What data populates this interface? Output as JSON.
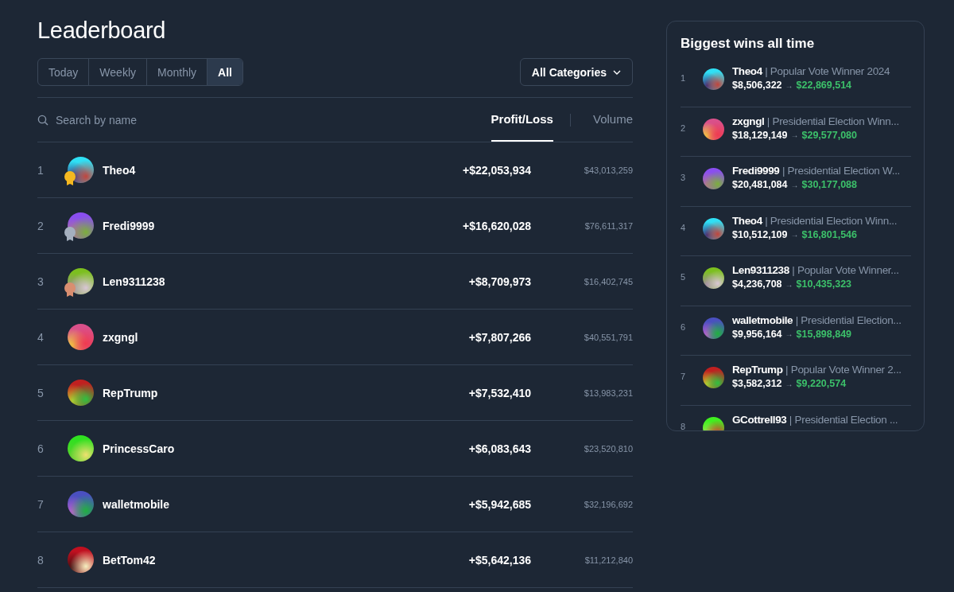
{
  "title": "Leaderboard",
  "periods": [
    {
      "label": "Today",
      "selected": false
    },
    {
      "label": "Weekly",
      "selected": false
    },
    {
      "label": "Monthly",
      "selected": false
    },
    {
      "label": "All",
      "selected": true
    }
  ],
  "category_filter": {
    "label": "All Categories"
  },
  "search": {
    "placeholder": "Search by name"
  },
  "sort_tabs": [
    {
      "label": "Profit/Loss",
      "selected": true
    },
    {
      "label": "Volume",
      "selected": false
    }
  ],
  "rows": [
    {
      "rank": "1",
      "name": "Theo4",
      "medal": {
        "color": "#f5b820"
      },
      "profit": "+$22,053,934",
      "volume": "$43,013,259"
    },
    {
      "rank": "2",
      "name": "Fredi9999",
      "medal": {
        "color": "#a5b0bf"
      },
      "profit": "+$16,620,028",
      "volume": "$76,611,317"
    },
    {
      "rank": "3",
      "name": "Len9311238",
      "medal": {
        "color": "#d98e70"
      },
      "profit": "+$8,709,973",
      "volume": "$16,402,745"
    },
    {
      "rank": "4",
      "name": "zxgngl",
      "profit": "+$7,807,266",
      "volume": "$40,551,791"
    },
    {
      "rank": "5",
      "name": "RepTrump",
      "profit": "+$7,532,410",
      "volume": "$13,983,231"
    },
    {
      "rank": "6",
      "name": "PrincessCaro",
      "profit": "+$6,083,643",
      "volume": "$23,520,810"
    },
    {
      "rank": "7",
      "name": "walletmobile",
      "profit": "+$5,942,685",
      "volume": "$32,196,692"
    },
    {
      "rank": "8",
      "name": "BetTom42",
      "profit": "+$5,642,136",
      "volume": "$11,212,840"
    }
  ],
  "biggest_wins": {
    "title": "Biggest wins all time",
    "items": [
      {
        "rank": "1",
        "name": "Theo4",
        "market": "| Popular Vote Winner 2024",
        "stake": "$8,506,322",
        "arrow": "→",
        "payout": "$22,869,514"
      },
      {
        "rank": "2",
        "name": "zxgngl",
        "market": "| Presidential Election Winn...",
        "stake": "$18,129,149",
        "arrow": "→",
        "payout": "$29,577,080"
      },
      {
        "rank": "3",
        "name": "Fredi9999",
        "market": "| Presidential Election W...",
        "stake": "$20,481,084",
        "arrow": "→",
        "payout": "$30,177,088"
      },
      {
        "rank": "4",
        "name": "Theo4",
        "market": "| Presidential Election Winn...",
        "stake": "$10,512,109",
        "arrow": "→",
        "payout": "$16,801,546"
      },
      {
        "rank": "5",
        "name": "Len9311238",
        "market": "| Popular Vote Winner...",
        "stake": "$4,236,708",
        "arrow": "→",
        "payout": "$10,435,323"
      },
      {
        "rank": "6",
        "name": "walletmobile",
        "market": "| Presidential Election...",
        "stake": "$9,956,164",
        "arrow": "→",
        "payout": "$15,898,849"
      },
      {
        "rank": "7",
        "name": "RepTrump",
        "market": "| Popular Vote Winner 2...",
        "stake": "$3,582,312",
        "arrow": "→",
        "payout": "$9,220,574"
      },
      {
        "rank": "8",
        "name": "GCottrell93",
        "market": "| Presidential Election ..."
      }
    ]
  }
}
